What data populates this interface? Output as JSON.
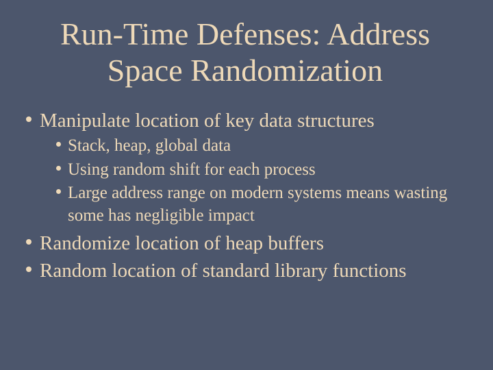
{
  "title": "Run-Time Defenses: Address Space Randomization",
  "bullets": [
    {
      "text": "Manipulate location of key data structures",
      "sub": [
        "Stack, heap, global data",
        "Using random shift for each process",
        "Large address range on modern systems means wasting some has negligible impact"
      ]
    },
    {
      "text": "Randomize location of heap buffers",
      "sub": []
    },
    {
      "text": "Random location of standard library functions",
      "sub": []
    }
  ]
}
